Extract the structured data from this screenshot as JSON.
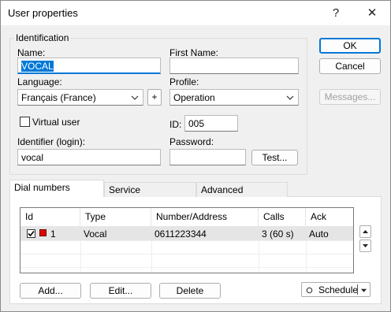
{
  "window": {
    "title": "User properties",
    "help_glyph": "?",
    "close_glyph": "✕"
  },
  "identification": {
    "group_label": "Identification",
    "name_label": "Name:",
    "name_value": "VOCAL",
    "first_name_label": "First Name:",
    "first_name_value": "",
    "language_label": "Language:",
    "language_value": "Français (France)",
    "add_language_label": "+",
    "profile_label": "Profile:",
    "profile_value": "Operation",
    "virtual_user_label": "Virtual user",
    "virtual_user_checked": false,
    "id_label": "ID:",
    "id_value": "005",
    "identifier_label": "Identifier (login):",
    "identifier_value": "vocal",
    "password_label": "Password:",
    "password_value": "",
    "test_label": "Test..."
  },
  "buttons": {
    "ok": "OK",
    "cancel": "Cancel",
    "messages": "Messages..."
  },
  "tabs": [
    {
      "label": "Dial numbers",
      "active": true
    },
    {
      "label": "Service",
      "active": false
    },
    {
      "label": "Advanced",
      "active": false
    }
  ],
  "dial_numbers": {
    "columns": [
      "Id",
      "Type",
      "Number/Address",
      "Calls",
      "Ack"
    ],
    "rows": [
      {
        "checked": true,
        "color": "#e00000",
        "id": "1",
        "type": "Vocal",
        "number": "0611223344",
        "calls": "3 (60 s)",
        "ack": "Auto"
      }
    ],
    "add_label": "Add...",
    "edit_label": "Edit...",
    "delete_label": "Delete",
    "schedule_label": "Schedule",
    "move_up_glyph": "▲",
    "move_down_glyph": "▼",
    "schedule_dropdown_glyph": "▼"
  },
  "colors": {
    "selection": "#0078d7",
    "default_button_border": "#0078d7",
    "row_marker": "#e00000"
  }
}
